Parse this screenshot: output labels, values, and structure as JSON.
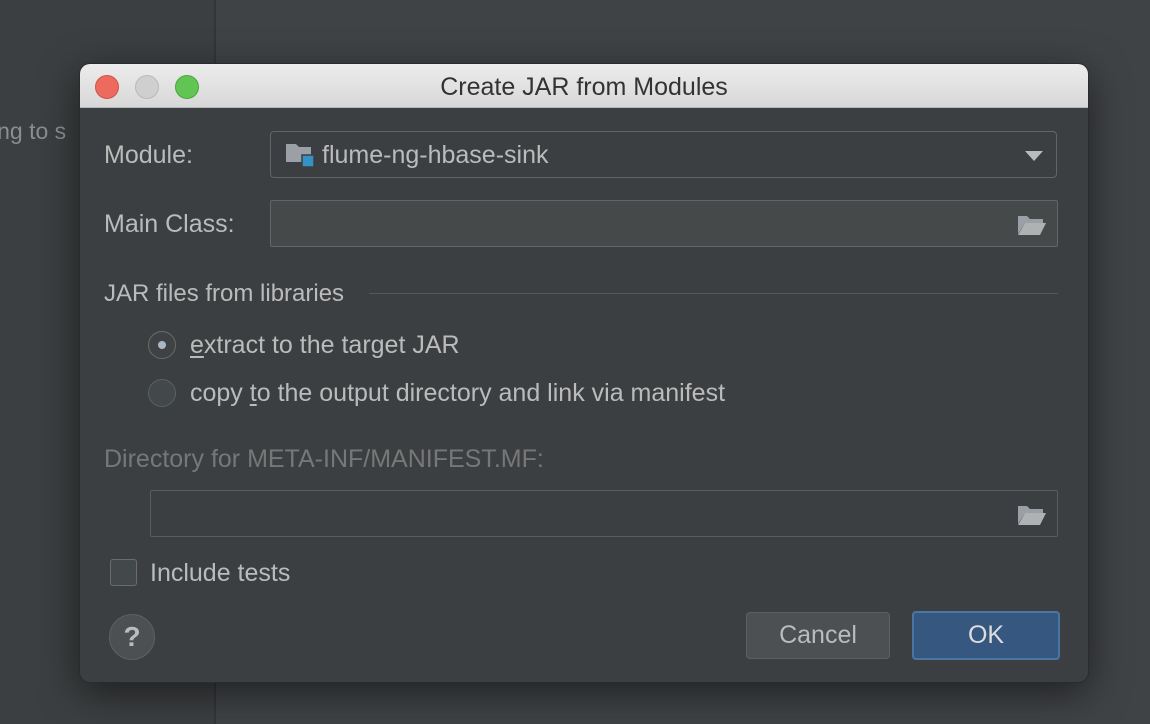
{
  "background": {
    "partial_text": "ing to s"
  },
  "dialog": {
    "title": "Create JAR from Modules",
    "module_label": "Module:",
    "module_value": "flume-ng-hbase-sink",
    "main_class_label": "Main Class:",
    "main_class_value": "",
    "libraries_section_label": "JAR files from libraries",
    "options": [
      {
        "prefix": "",
        "mnemonic": "e",
        "suffix": "xtract to the target JAR",
        "selected": true
      },
      {
        "prefix": "copy ",
        "mnemonic": "t",
        "suffix": "o the output directory and link via manifest",
        "selected": false
      }
    ],
    "manifest_dir_label": "Directory for META-INF/MANIFEST.MF:",
    "manifest_dir_value": "",
    "include_tests_label": "Include tests",
    "include_tests_checked": false,
    "help_label": "?",
    "cancel_label": "Cancel",
    "ok_label": "OK"
  },
  "colors": {
    "accent_button": "#365880",
    "module_icon_badge": "#3592c4"
  },
  "icons": {
    "module": "module-folder-icon",
    "browse": "folder-open-icon",
    "dropdown": "chevron-down-icon"
  }
}
